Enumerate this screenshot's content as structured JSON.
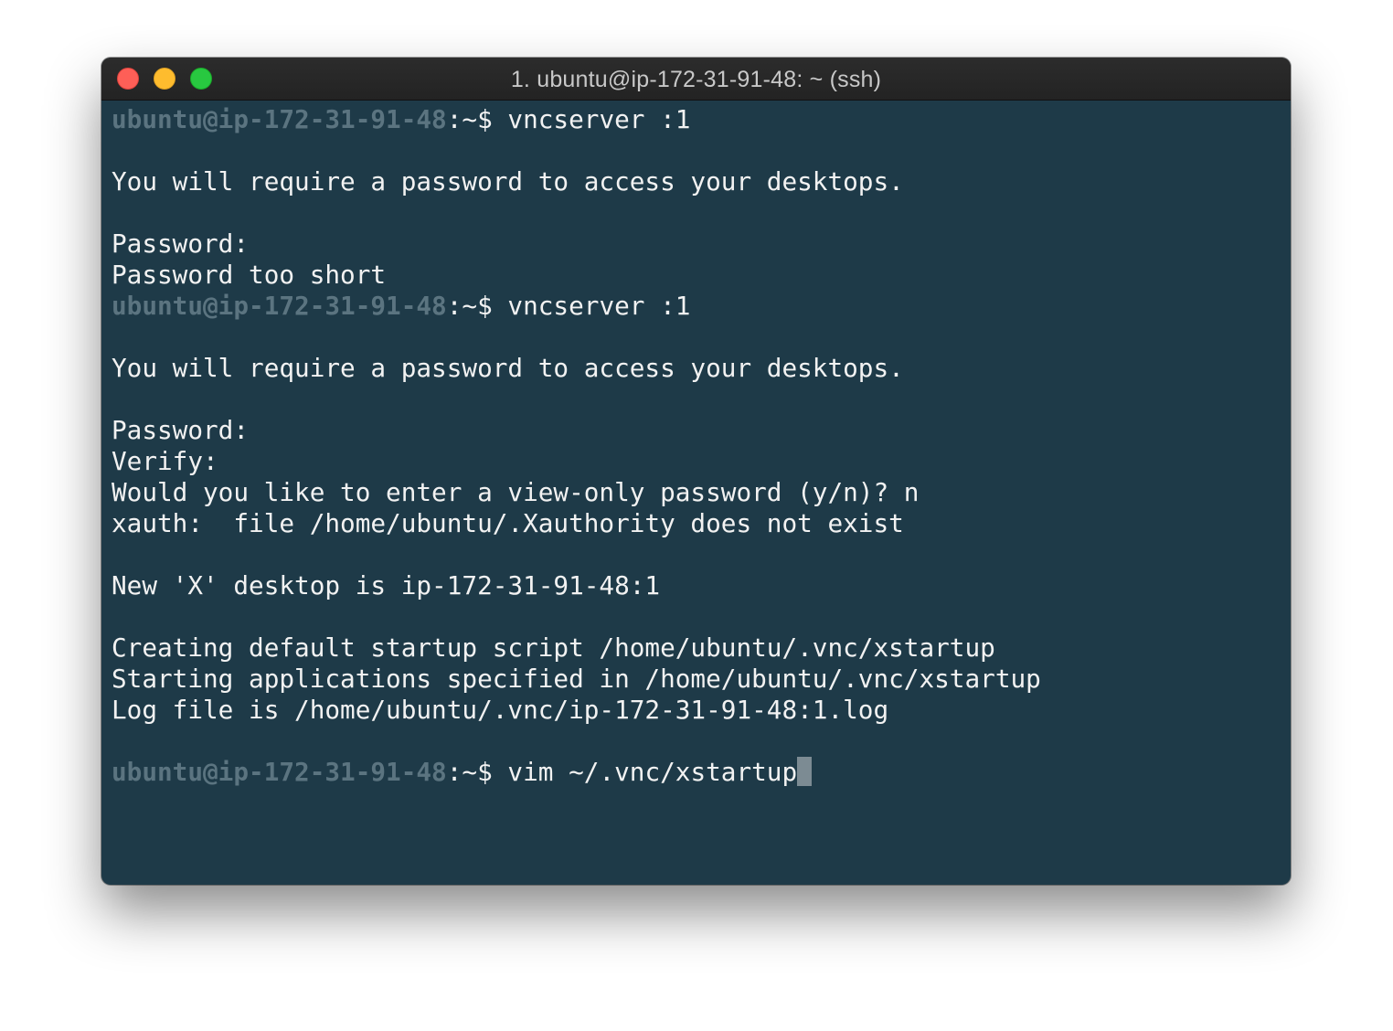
{
  "window": {
    "title": "1. ubuntu@ip-172-31-91-48: ~ (ssh)"
  },
  "colors": {
    "terminal_background": "#1e3a48",
    "prompt_user": "#5b7480",
    "text": "#f2f2f2",
    "close": "#fe5f57",
    "minimize": "#febc2e",
    "zoom": "#28c840"
  },
  "terminal": {
    "lines": [
      {
        "prompt": "ubuntu@ip-172-31-91-48",
        "path": ":~$ ",
        "text": "vncserver :1"
      },
      {
        "text": ""
      },
      {
        "text": "You will require a password to access your desktops."
      },
      {
        "text": ""
      },
      {
        "text": "Password:"
      },
      {
        "text": "Password too short"
      },
      {
        "prompt": "ubuntu@ip-172-31-91-48",
        "path": ":~$ ",
        "text": "vncserver :1"
      },
      {
        "text": ""
      },
      {
        "text": "You will require a password to access your desktops."
      },
      {
        "text": ""
      },
      {
        "text": "Password:"
      },
      {
        "text": "Verify:"
      },
      {
        "text": "Would you like to enter a view-only password (y/n)? n"
      },
      {
        "text": "xauth:  file /home/ubuntu/.Xauthority does not exist"
      },
      {
        "text": ""
      },
      {
        "text": "New 'X' desktop is ip-172-31-91-48:1"
      },
      {
        "text": ""
      },
      {
        "text": "Creating default startup script /home/ubuntu/.vnc/xstartup"
      },
      {
        "text": "Starting applications specified in /home/ubuntu/.vnc/xstartup"
      },
      {
        "text": "Log file is /home/ubuntu/.vnc/ip-172-31-91-48:1.log"
      },
      {
        "text": ""
      },
      {
        "prompt": "ubuntu@ip-172-31-91-48",
        "path": ":~$ ",
        "text": "vim ~/.vnc/xstartup",
        "cursor": true
      }
    ]
  }
}
